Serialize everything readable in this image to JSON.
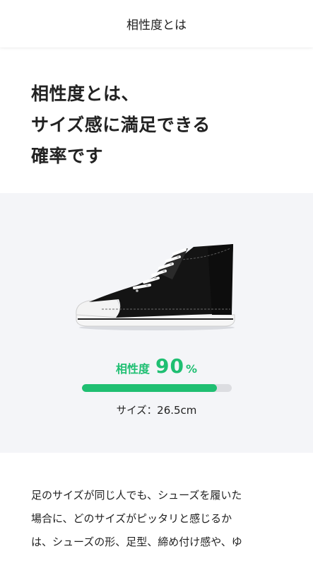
{
  "header": {
    "title": "相性度とは"
  },
  "headline": {
    "lines": [
      "相性度とは、",
      "サイズ感に満足できる",
      "確率です"
    ]
  },
  "compat": {
    "label": "相性度",
    "value": "90",
    "unit": "%",
    "fill_fraction": 0.9,
    "size_label": "サイズ：",
    "size_value": "26.5cm",
    "accent_color": "#1fbf72"
  },
  "shoe_image": {
    "icon": "high-top-sneaker-icon"
  },
  "description": {
    "lines": [
      "足のサイズが同じ人でも、シューズを履いた",
      "場合に、どのサイズがピッタリと感じるか",
      "は、シューズの形、足型、締め付け感や、ゆ"
    ]
  }
}
